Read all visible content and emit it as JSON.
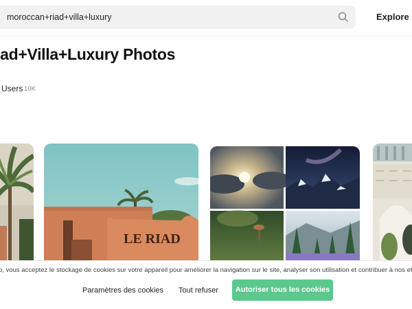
{
  "header": {
    "search_value": "moroccan+riad+villa+luxury",
    "search_icon": "search-icon",
    "explore_label": "Explore"
  },
  "page": {
    "title": "iad+Villa+Luxury Photos"
  },
  "tabs": {
    "users_label": "Users",
    "users_count": "10K"
  },
  "photos": {
    "riad_sign_text": "LE RIAD"
  },
  "cookie": {
    "text": "o, vous acceptez le stockage de cookies sur votre appareil pour améliorer la navigation sur le site, analyser son utilisation et contribuer à nos ef",
    "settings_label": "Paramètres des cookies",
    "refuse_label": "Tout refuser",
    "accept_label": "Autoriser tous les cookies",
    "accept_color": "#5bc88d"
  }
}
